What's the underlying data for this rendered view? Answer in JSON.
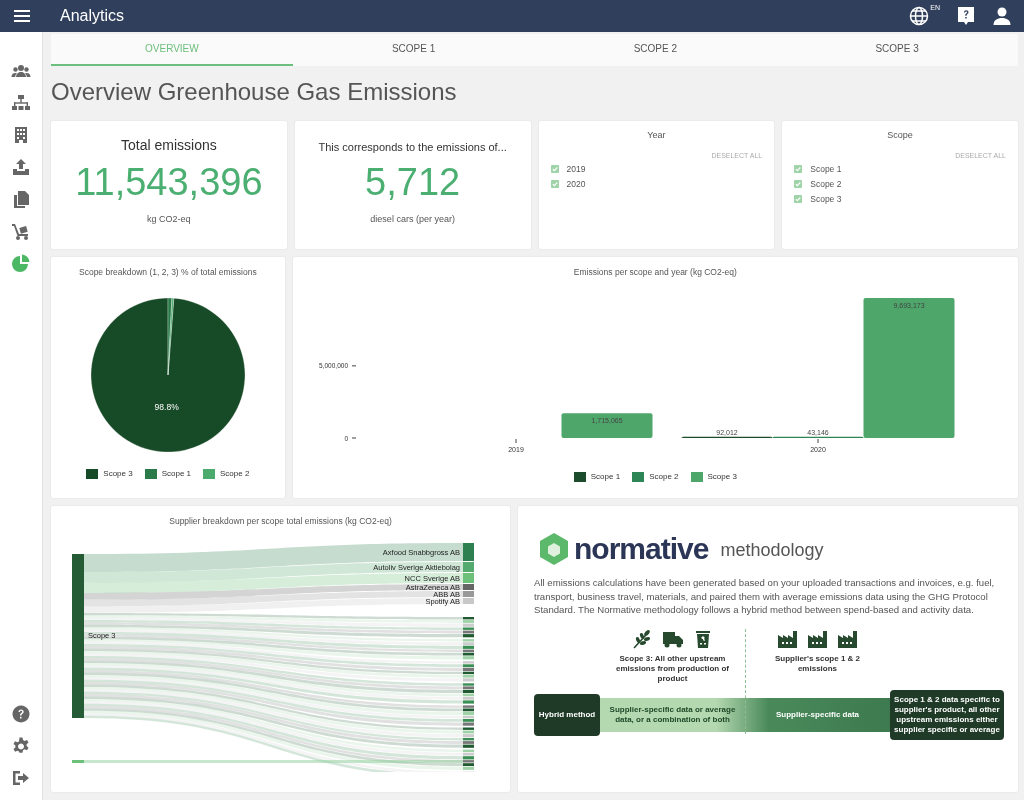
{
  "header": {
    "title": "Analytics",
    "language": "EN"
  },
  "sidebar": {
    "items": [
      {
        "selected": false
      },
      {
        "selected": false
      },
      {
        "selected": false
      },
      {
        "selected": false
      },
      {
        "selected": false
      },
      {
        "selected": false
      },
      {
        "selected": true
      }
    ]
  },
  "tabs": [
    {
      "label": "OVERVIEW",
      "selected": true
    },
    {
      "label": "SCOPE 1",
      "selected": false
    },
    {
      "label": "SCOPE 2",
      "selected": false
    },
    {
      "label": "SCOPE 3",
      "selected": false
    }
  ],
  "page_title": "Overview Greenhouse Gas Emissions",
  "total": {
    "title": "Total emissions",
    "value": "11,543,396",
    "unit": "kg CO2-eq"
  },
  "equivalent": {
    "title": "This corresponds to the emissions of...",
    "value": "5,712",
    "unit": "diesel cars (per year)"
  },
  "filters": [
    {
      "title": "Year",
      "action": "DESELECT ALL",
      "options": [
        {
          "label": "2019",
          "checked": true
        },
        {
          "label": "2020",
          "checked": true
        }
      ]
    },
    {
      "title": "Scope",
      "action": "DESELECT ALL",
      "options": [
        {
          "label": "Scope 1",
          "checked": true
        },
        {
          "label": "Scope 2",
          "checked": true
        },
        {
          "label": "Scope 3",
          "checked": true
        }
      ]
    }
  ],
  "pie": {
    "chart_data": {
      "type": "pie",
      "title": "Scope breakdown (1, 2, 3) % of total emissions",
      "categories": [
        "Scope 3",
        "Scope 1",
        "Scope 2"
      ],
      "values": [
        98.8,
        0.8,
        0.4
      ],
      "colors": [
        "#174a26",
        "#2a7a4a",
        "#4caa6c"
      ],
      "value_labels": [
        "98.8%",
        null,
        null
      ]
    }
  },
  "bars": {
    "chart_data": {
      "type": "bar",
      "title": "Emissions per scope and year (kg CO2-eq)",
      "categories": [
        "2019",
        "2020"
      ],
      "series": [
        {
          "name": "Scope 1",
          "color": "#1b4d2c",
          "values": [
            null,
            92012
          ],
          "value_labels": [
            null,
            "92,012"
          ]
        },
        {
          "name": "Scope 2",
          "color": "#2e8555",
          "values": [
            null,
            43146
          ],
          "value_labels": [
            null,
            "43,146"
          ]
        },
        {
          "name": "Scope 3",
          "color": "#4ea66b",
          "values": [
            1715065,
            9693173
          ],
          "value_labels": [
            "1,715,065",
            "9,693,173"
          ]
        }
      ],
      "ylim": [
        0,
        9840000
      ],
      "yticks": [
        {
          "value": 0,
          "label": "0"
        },
        {
          "value": 5000000,
          "label": "5,000,000"
        }
      ],
      "data_labels": true
    }
  },
  "sankey": {
    "title": "Supplier breakdown per scope total emissions (kg CO2-eq)",
    "source": {
      "label": "Scope 3",
      "color": "#265c35"
    },
    "targets": [
      {
        "label": "Axfood Snabbgross AB",
        "color": "#2e8050"
      },
      {
        "label": "Autoliv Sverige Aktiebolag",
        "color": "#55aa70"
      },
      {
        "label": "NCC Sverige AB",
        "color": "#6cc07a"
      },
      {
        "label": "AstraZeneca AB",
        "color": "#666666"
      },
      {
        "label": "ABB AB",
        "color": "#999999"
      },
      {
        "label": "Spotify AB",
        "color": "#c8c8c8"
      }
    ]
  },
  "methodology": {
    "brand": "normative",
    "heading": "methodology",
    "text": "All emissions calculations have been generated based on your uploaded transactions and invoices, e.g. fuel, transport, business travel, materials, and paired them with average emissions data using the GHG Protocol Standard. The Normative methodology follows a hybrid method between spend-based and activity data.",
    "scope3_caption": "Scope 3: All other upstream emissions from production of product",
    "supplier_caption": "Supplier's scope 1 & 2 emissions",
    "method": "Hybrid method",
    "band": [
      "Supplier-specific data or average data, or a combination of both",
      "Supplier-specific data"
    ],
    "result": "Scope 1 & 2 data specific to supplier's product, all other upstream emissions either supplier specific or average"
  }
}
